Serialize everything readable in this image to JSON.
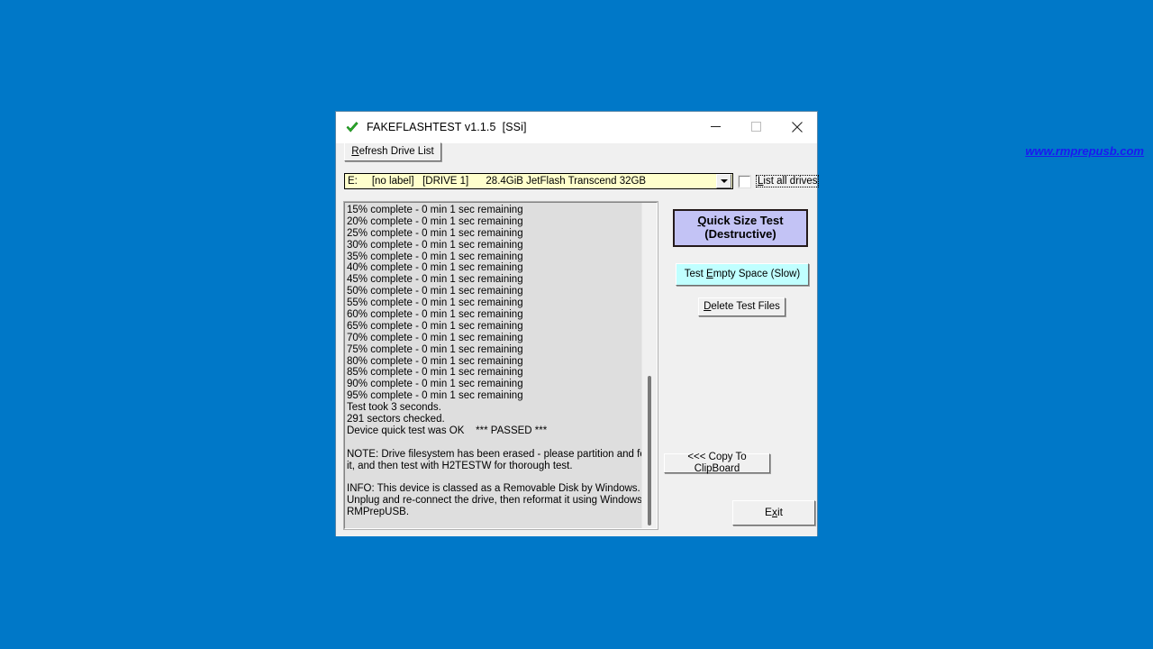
{
  "window": {
    "title": "FAKEFLASHTEST v1.1.5  [SSi]",
    "icon": "green-check-icon",
    "minimize_label": "minimize-icon",
    "maximize_label": "maximize-icon",
    "close_label": "close-icon",
    "accent_blue": "#0078c8",
    "border_color": "#5a87a8"
  },
  "toolbar": {
    "refresh_label_prefix": "R",
    "refresh_label_rest": "efresh Drive List",
    "website": "www.rmprepusb.com",
    "website_color": "#1a1af0"
  },
  "drive": {
    "selected": "E:     [no label]   [DRIVE 1]      28.4GiB JetFlash Transcend 32GB",
    "dropdown_icon": "chevron-down-icon",
    "field_bg": "#ffffcc",
    "options": [
      "E:     [no label]   [DRIVE 1]      28.4GiB JetFlash Transcend 32GB"
    ]
  },
  "list_all_drives": {
    "label_prefix": "L",
    "label_rest": "ist all drives",
    "checked": false
  },
  "log": {
    "bg": "#dedede",
    "lines": [
      "15% complete - 0 min 1 sec remaining",
      "20% complete - 0 min 1 sec remaining",
      "25% complete - 0 min 1 sec remaining",
      "30% complete - 0 min 1 sec remaining",
      "35% complete - 0 min 1 sec remaining",
      "40% complete - 0 min 1 sec remaining",
      "45% complete - 0 min 1 sec remaining",
      "50% complete - 0 min 1 sec remaining",
      "55% complete - 0 min 1 sec remaining",
      "60% complete - 0 min 1 sec remaining",
      "65% complete - 0 min 1 sec remaining",
      "70% complete - 0 min 1 sec remaining",
      "75% complete - 0 min 1 sec remaining",
      "80% complete - 0 min 1 sec remaining",
      "85% complete - 0 min 1 sec remaining",
      "90% complete - 0 min 1 sec remaining",
      "95% complete - 0 min 1 sec remaining",
      "Test took 3 seconds.",
      "291 sectors checked.",
      "Device quick test was OK    *** PASSED ***",
      "",
      "NOTE: Drive filesystem has been erased - please partition and format",
      "it, and then test with H2TESTW for thorough test.",
      "",
      "INFO: This device is classed as a Removable Disk by Windows.",
      "Unplug and re-connect the drive, then reformat it using Windows or",
      "RMPrepUSB."
    ],
    "scrollbar": {
      "thumb_color": "#7a7a7a"
    }
  },
  "actions": {
    "quick_size_test_line1_prefix": "Q",
    "quick_size_test_line1_rest": "uick Size Test",
    "quick_size_test_line2": "(Destructive)",
    "quick_size_test_bg": "#c3c3f5",
    "test_empty_space_pre": "Test ",
    "test_empty_space_accel": "E",
    "test_empty_space_post": "mpty Space (Slow)",
    "test_empty_space_bg": "#c0ffff",
    "delete_test_files_prefix": "D",
    "delete_test_files_rest": "elete Test Files",
    "copy_to_clipboard": "<<< Copy To ClipBoard",
    "exit_pre": "E",
    "exit_accel": "x",
    "exit_post": "it"
  }
}
